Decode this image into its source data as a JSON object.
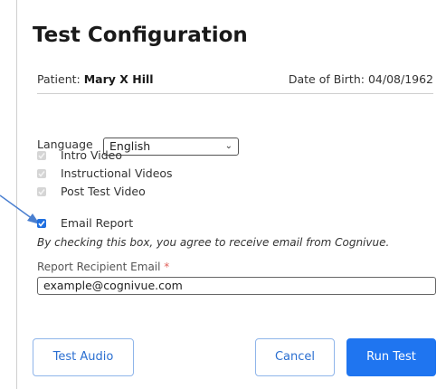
{
  "dialog": {
    "title": "Test Configuration"
  },
  "patient": {
    "label": "Patient:",
    "name": "Mary X Hill",
    "dob_label": "Date of Birth:",
    "dob": "04/08/1962"
  },
  "language": {
    "label": "Language",
    "selected": "English"
  },
  "options": [
    {
      "label": "Intro Video",
      "checked": false,
      "disabled": true
    },
    {
      "label": "Instructional Videos",
      "checked": false,
      "disabled": true
    },
    {
      "label": "Post Test Video",
      "checked": false,
      "disabled": true
    },
    {
      "label": "Email Report",
      "checked": true,
      "disabled": false
    }
  ],
  "consent_text": "By checking this box, you agree to receive email from Cognivue.",
  "email": {
    "label": "Report Recipient Email",
    "required_mark": "*",
    "value": "example@cognivue.com"
  },
  "buttons": {
    "test_audio": "Test Audio",
    "cancel": "Cancel",
    "run_test": "Run Test"
  },
  "colors": {
    "accent": "#1f75f0",
    "outline_button_text": "#2b6fd1",
    "required": "#e0605a",
    "annotation_arrow": "#4a7fd0"
  },
  "icons": {
    "language_dropdown": "chevron-down-icon",
    "checkbox_checked": "checkmark-icon",
    "annotation": "arrow-icon"
  }
}
